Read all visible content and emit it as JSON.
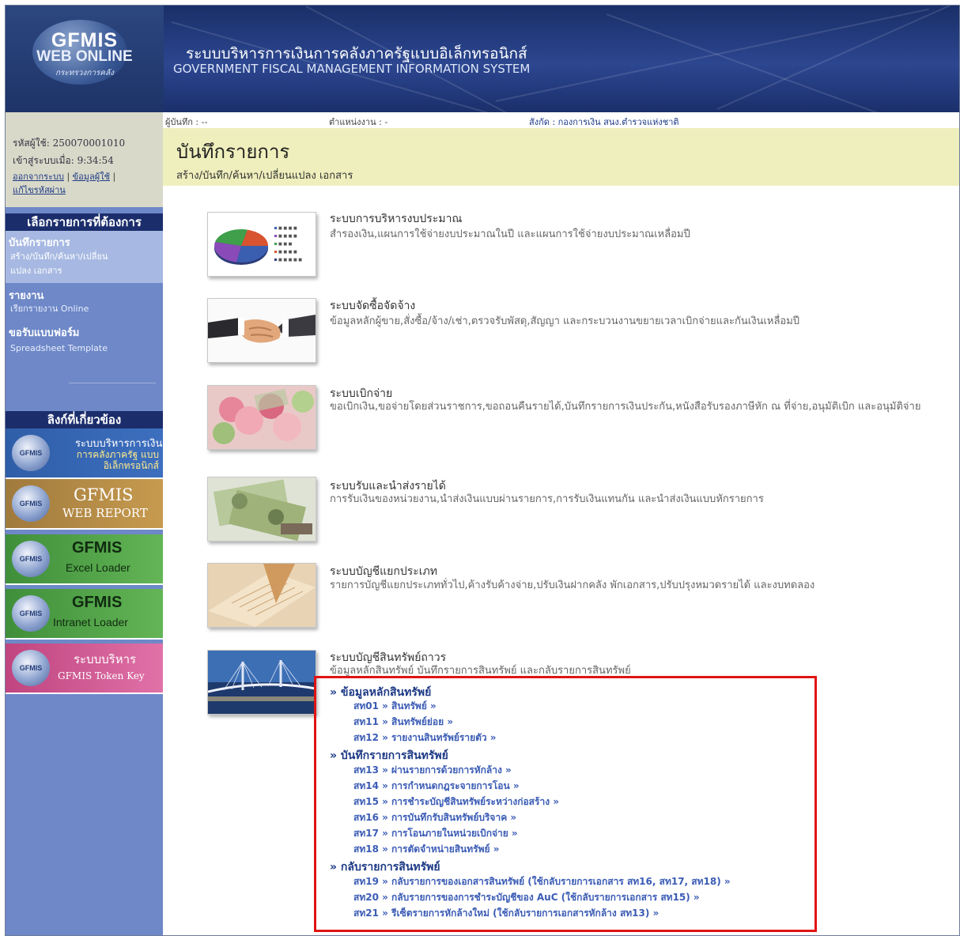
{
  "header": {
    "logo_title": "GFMIS",
    "logo_subtitle": "WEB ONLINE",
    "logo_ministry": "กระทรวงการคลัง",
    "system_name_th": "ระบบบริหารการเงินการคลังภาครัฐแบบอิเล็กทรอนิกส์",
    "system_name_en": "GOVERNMENT FISCAL MANAGEMENT INFORMATION SYSTEM"
  },
  "user": {
    "user_id": "รหัสผู้ใช้: 250070001010",
    "login_time": "เข้าสู่ระบบเมื่อ: 9:34:54",
    "logout_link": "ออกจากระบบ",
    "profile_link": "ข้อมูลผู้ใช้",
    "change_password_link": "แก้ไขรหัสผ่าน"
  },
  "infobar": {
    "recorder": "ผู้บันทึก : --",
    "position": "ตำแหน่งงาน : -",
    "department": "สังกัด : กองการเงิน สนง.ตำรวจแห่งชาติ"
  },
  "sidebar": {
    "menu_header": "เลือกรายการที่ต้องการ",
    "items": [
      {
        "title": "บันทึกรายการ",
        "sub": [
          "สร้าง/บันทึก/ค้นหา/เปลี่ยน",
          "แปลง เอกสาร"
        ]
      },
      {
        "title": "รายงาน",
        "sub": [
          "เรียกรายงาน Online"
        ]
      },
      {
        "title": "ขอรับแบบฟอร์ม",
        "sub": [
          "Spreadsheet Template"
        ]
      }
    ],
    "links_header": "ลิงก์ที่เกี่ยวข้อง",
    "banners": [
      {
        "badge": "GFMIS",
        "line1": "ระบบบริหารการเงิน",
        "line2": "การคลังภาครัฐ แบบอิเล็กทรอนิกส์"
      },
      {
        "badge": "GFMIS",
        "line1": "GFMIS",
        "line2": "WEB REPORT"
      },
      {
        "badge": "GFMIS",
        "line1": "GFMIS",
        "line2": "Excel Loader"
      },
      {
        "badge": "GFMIS",
        "line1": "GFMIS",
        "line2": "Intranet Loader"
      },
      {
        "badge": "GFMIS",
        "line1": "ระบบบริหาร",
        "line2": "GFMIS Token Key"
      }
    ]
  },
  "page": {
    "title": "บันทึกรายการ",
    "subtitle": "สร้าง/บันทึก/ค้นหา/เปลี่ยนแปลง เอกสาร"
  },
  "systems": [
    {
      "title": "ระบบการบริหารงบประมาณ",
      "desc": "สำรองเงิน,แผนการใช้จ่ายงบประมาณในปี และแผนการใช้จ่ายงบประมาณเหลื่อมปี",
      "image": "pie-chart-image"
    },
    {
      "title": "ระบบจัดซื้อจัดจ้าง",
      "desc": "ข้อมูลหลักผู้ขาย,สั่งซื้อ/จ้าง/เช่า,ตรวจรับพัสดุ,สัญญา และกระบวนงานขยายเวลาเบิกจ่ายและกันเงินเหลื่อมปี",
      "image": "handshake-image"
    },
    {
      "title": "ระบบเบิกจ่าย",
      "desc": "ขอเบิกเงิน,ขอจ่ายโดยส่วนราชการ,ขอถอนคืนรายได้,บันทึกรายการเงินประกัน,หนังสือรับรองภาษีหัก ณ ที่จ่าย,อนุมัติเบิก และอนุมัติจ่าย",
      "image": "money-flowers-image"
    },
    {
      "title": "ระบบรับและนำส่งรายได้",
      "desc": "การรับเงินของหน่วยงาน,นำส่งเงินแบบผ่านรายการ,การรับเงินแทนกัน และนำส่งเงินแบบหักรายการ",
      "image": "banknotes-image"
    },
    {
      "title": "ระบบบัญชีแยกประเภท",
      "desc": "รายการบัญชีแยกประเภททั่วไป,ค้างรับค้างจ่าย,ปรับเงินฝากคลัง พักเอกสาร,ปรับปรุงหมวดรายได้ และงบทดลอง",
      "image": "ledger-image"
    },
    {
      "title": "ระบบบัญชีสินทรัพย์ถาวร",
      "desc": "ข้อมูลหลักสินทรัพย์ บันทึกรายการสินทรัพย์ และกลับรายการสินทรัพย์",
      "image": "bridge-image"
    }
  ],
  "asset_menu": {
    "groups": [
      {
        "label": "» ข้อมูลหลักสินทรัพย์",
        "links": [
          "สท01 » สินทรัพย์ »",
          "สท11 » สินทรัพย์ย่อย »",
          "สท12 » รายงานสินทรัพย์รายตัว »"
        ]
      },
      {
        "label": "» บันทึกรายการสินทรัพย์",
        "links": [
          "สท13 » ผ่านรายการด้วยการหักล้าง »",
          "สท14 » การกำหนดกฎระจายการโอน »",
          "สท15 » การชำระบัญชีสินทรัพย์ระหว่างก่อสร้าง »",
          "สท16 » การบันทึกรับสินทรัพย์บริจาค »",
          "สท17 » การโอนภายในหน่วยเบิกจ่าย »",
          "สท18 » การตัดจำหน่ายสินทรัพย์ »"
        ]
      },
      {
        "label": "» กลับรายการสินทรัพย์",
        "links": [
          "สท19 » กลับรายการของเอกสารสินทรัพย์ (ใช้กลับรายการเอกสาร สท16, สท17, สท18) »",
          "สท20 » กลับรายการของการชำระบัญชีของ AuC (ใช้กลับรายการเอกสาร สท15) »",
          "สท21 » รีเซ็ตรายการหักล้างใหม่ (ใช้กลับรายการเอกสารหักล้าง สท13) »"
        ]
      }
    ]
  },
  "colors": {
    "header_bg": "#24397a",
    "sidebar_bg": "#6e88c8",
    "title_band_bg": "#efefbd",
    "link_color": "#3b5cb5",
    "highlight_border": "#e01313"
  }
}
